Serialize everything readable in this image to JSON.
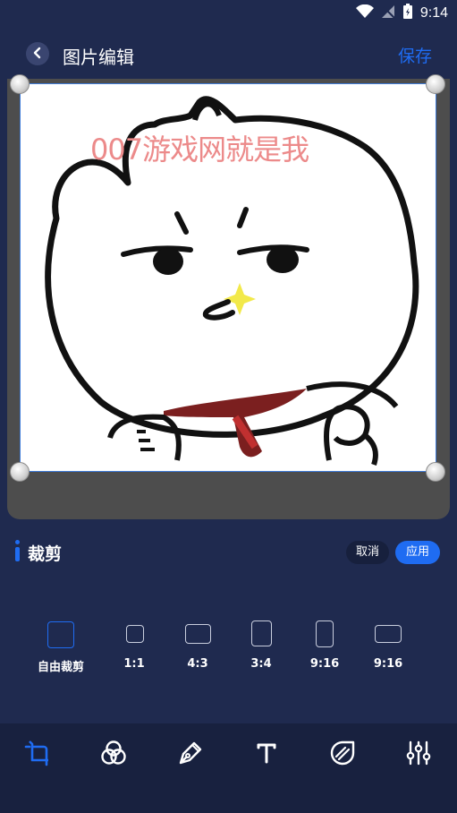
{
  "status_bar": {
    "time": "9:14"
  },
  "header": {
    "title": "图片编辑",
    "save_label": "保存"
  },
  "canvas": {
    "watermark": "007游戏网就是我"
  },
  "panel": {
    "title": "裁剪",
    "cancel_label": "取消",
    "apply_label": "应用",
    "ratios": [
      {
        "label": "自由裁剪"
      },
      {
        "label": "1:1"
      },
      {
        "label": "4:3"
      },
      {
        "label": "3:4"
      },
      {
        "label": "9:16"
      },
      {
        "label": "9:16"
      }
    ]
  },
  "toolbar": {
    "tools": [
      "crop-icon",
      "filter-icon",
      "pen-icon",
      "text-icon",
      "sticker-icon",
      "adjust-icon"
    ]
  },
  "colors": {
    "accent": "#1f6cf2",
    "background": "#1f2a4f",
    "toolbar": "#18213f",
    "watermark": "#ec8a8a"
  }
}
